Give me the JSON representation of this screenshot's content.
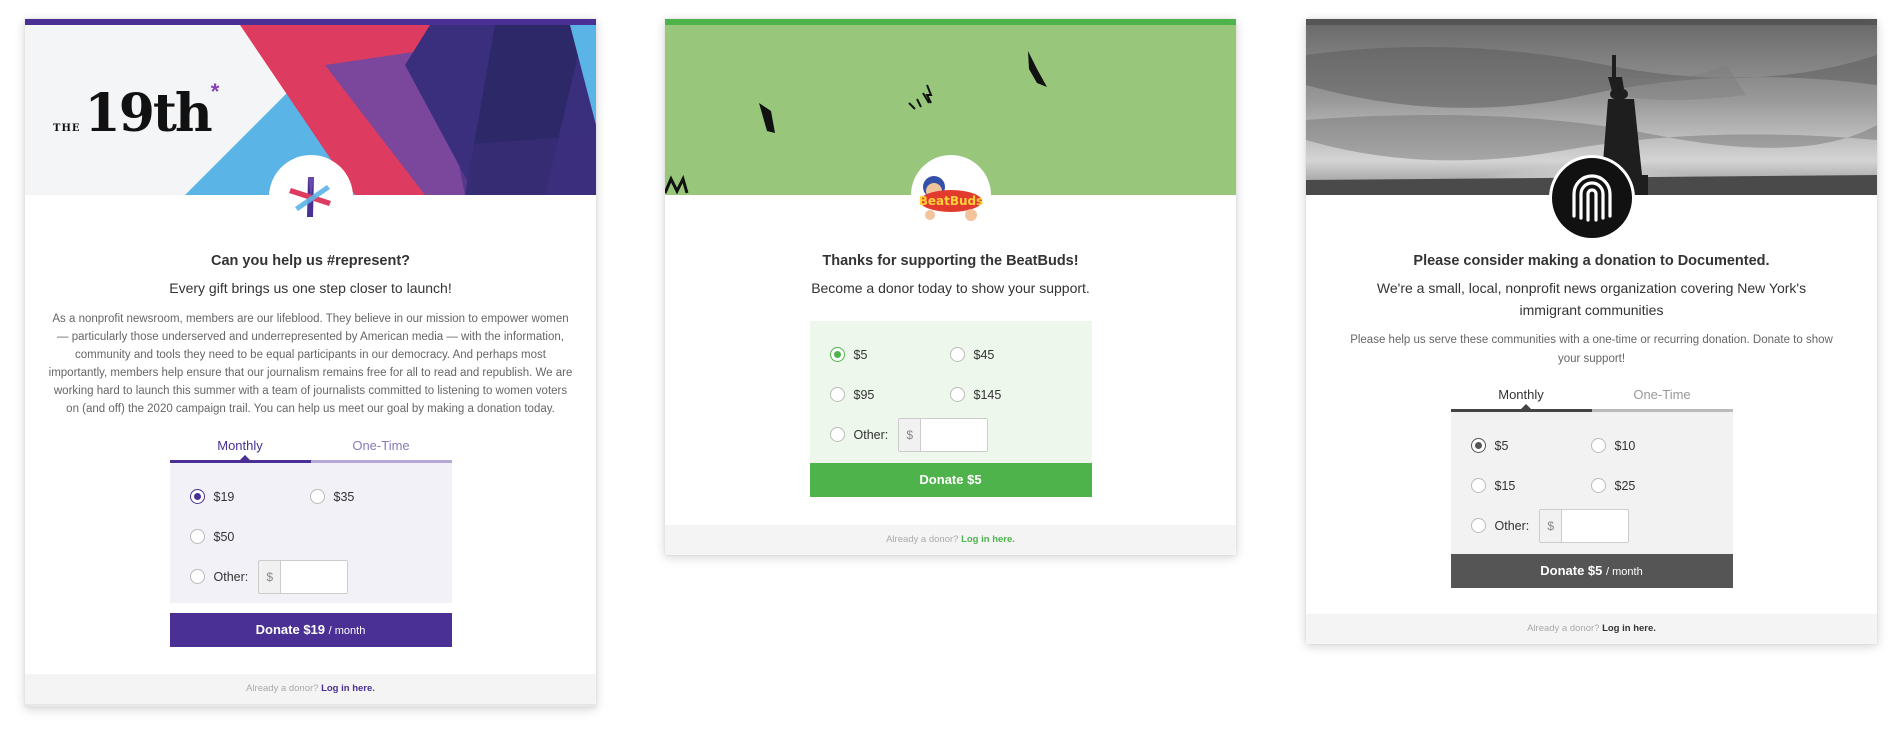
{
  "cards": [
    {
      "org": "The 19th",
      "accent": "#4a3094",
      "logo_wordmark": "19th",
      "logo_prefix": "THE",
      "title": "Can you help us #represent?",
      "subtitle": "Every gift brings us one step closer to launch!",
      "description": "As a nonprofit newsroom, members are our lifeblood. They believe in our mission to empower women — particularly those underserved and underrepresented by American media — with the information, community and tools they need to be equal participants in our democracy. And perhaps most importantly, members help ensure that our journalism remains free for all to read and republish. We are working hard to launch this summer with a team of journalists committed to listening to women voters on (and off) the 2020 campaign trail. You can help us meet our goal by making a donation today.",
      "tabs": [
        "Monthly",
        "One-Time"
      ],
      "active_tab": "Monthly",
      "amounts": [
        "$19",
        "$35",
        "$50"
      ],
      "selected_amount": "$19",
      "other_label": "Other:",
      "currency_symbol": "$",
      "donate_label": "Donate $19",
      "donate_period": "/ month",
      "footer_text": "Already a donor?",
      "footer_link": "Log in here."
    },
    {
      "org": "BeatBuds",
      "accent": "#4db34a",
      "banner_color": "#98c77b",
      "title": "Thanks for supporting the BeatBuds!",
      "subtitle": "Become a donor today to show your support.",
      "amounts": [
        "$5",
        "$45",
        "$95",
        "$145"
      ],
      "selected_amount": "$5",
      "other_label": "Other:",
      "currency_symbol": "$",
      "donate_label": "Donate $5",
      "footer_text": "Already a donor?",
      "footer_link": "Log in here."
    },
    {
      "org": "Documented",
      "accent": "#555555",
      "title": "Please consider making a donation to Documented.",
      "subtitle": "We're a small, local, nonprofit news organization covering New York's immigrant communities",
      "description": "Please help us serve these communities with a one-time or recurring donation. Donate to show your support!",
      "tabs": [
        "Monthly",
        "One-Time"
      ],
      "active_tab": "Monthly",
      "amounts": [
        "$5",
        "$10",
        "$15",
        "$25"
      ],
      "selected_amount": "$5",
      "other_label": "Other:",
      "currency_symbol": "$",
      "donate_label": "Donate $5",
      "donate_period": "/ month",
      "footer_text": "Already a donor?",
      "footer_link": "Log in here."
    }
  ]
}
